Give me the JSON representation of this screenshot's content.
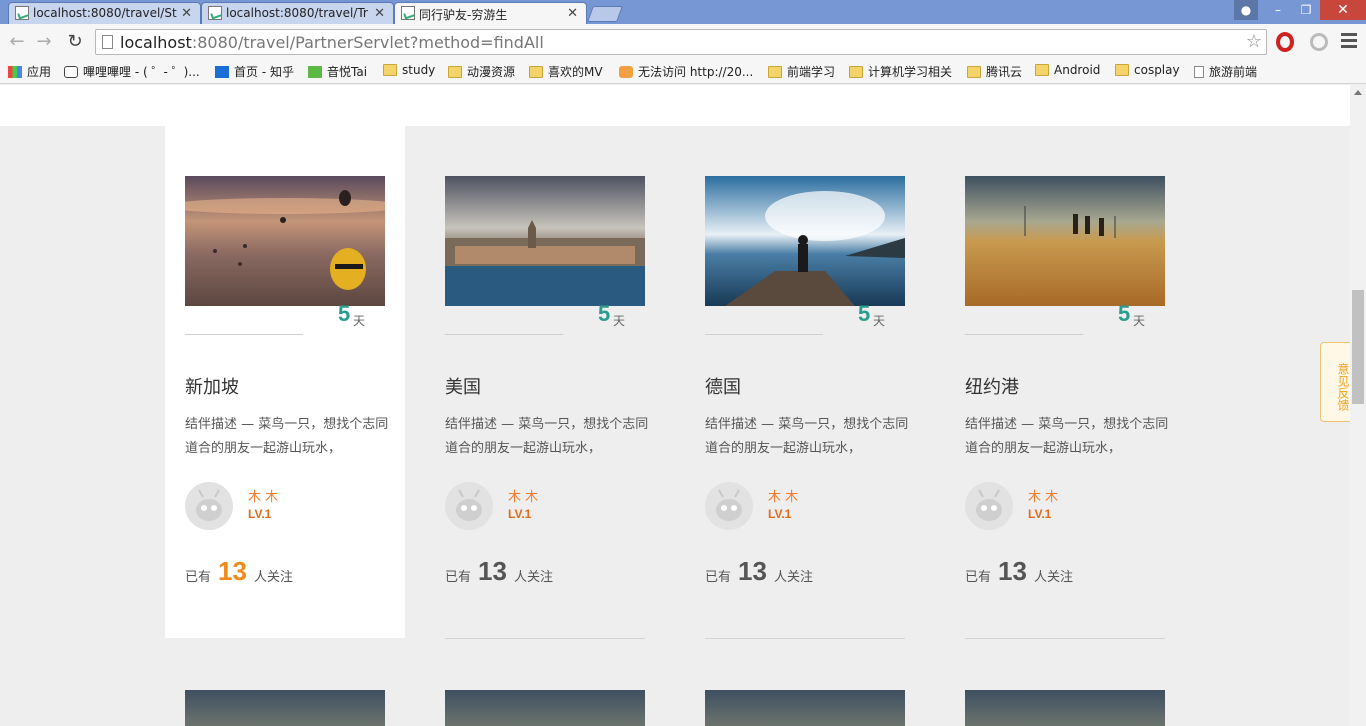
{
  "browser": {
    "tabs": [
      {
        "title": "localhost:8080/travel/St"
      },
      {
        "title": "localhost:8080/travel/Tr"
      },
      {
        "title": "同行驴友-穷游生"
      }
    ],
    "url_host": "localhost",
    "url_path": ":8080/travel/PartnerServlet?method=findAll",
    "bookmarks": [
      {
        "label": "应用",
        "icon": "apps-icon"
      },
      {
        "label": "嗶哩嗶哩 - ( ゜- ゜)...",
        "icon": "tv-icon"
      },
      {
        "label": "首页 - 知乎",
        "icon": "zhihu-icon"
      },
      {
        "label": "音悦Tai",
        "icon": "yinyuetai-icon"
      },
      {
        "label": "study",
        "icon": "folder-icon"
      },
      {
        "label": "动漫资源",
        "icon": "folder-icon"
      },
      {
        "label": "喜欢的MV",
        "icon": "folder-icon"
      },
      {
        "label": "无法访问 http://20...",
        "icon": "mu-icon"
      },
      {
        "label": "前端学习",
        "icon": "folder-icon"
      },
      {
        "label": "计算机学习相关",
        "icon": "folder-icon"
      },
      {
        "label": "腾讯云",
        "icon": "folder-icon"
      },
      {
        "label": "Android",
        "icon": "folder-icon"
      },
      {
        "label": "cosplay",
        "icon": "folder-icon"
      },
      {
        "label": "旅游前端",
        "icon": "page-icon"
      }
    ]
  },
  "feedback": {
    "label": "意见反馈"
  },
  "cards": [
    {
      "city": "新加坡",
      "days": "5",
      "days_unit": "天",
      "desc": "结伴描述 — 菜鸟一只，想找个志同道合的朋友一起游山玩水，",
      "user": "木 木",
      "level": "LV.1",
      "follow_pre": "已有",
      "follow_count": "13",
      "follow_post": "人关注",
      "highlight": true
    },
    {
      "city": "美国",
      "days": "5",
      "days_unit": "天",
      "desc": "结伴描述 — 菜鸟一只，想找个志同道合的朋友一起游山玩水，",
      "user": "木 木",
      "level": "LV.1",
      "follow_pre": "已有",
      "follow_count": "13",
      "follow_post": "人关注",
      "highlight": false
    },
    {
      "city": "德国",
      "days": "5",
      "days_unit": "天",
      "desc": "结伴描述 — 菜鸟一只，想找个志同道合的朋友一起游山玩水，",
      "user": "木 木",
      "level": "LV.1",
      "follow_pre": "已有",
      "follow_count": "13",
      "follow_post": "人关注",
      "highlight": false
    },
    {
      "city": "纽约港",
      "days": "5",
      "days_unit": "天",
      "desc": "结伴描述 — 菜鸟一只，想找个志同道合的朋友一起游山玩水，",
      "user": "木 木",
      "level": "LV.1",
      "follow_pre": "已有",
      "follow_count": "13",
      "follow_post": "人关注",
      "highlight": false
    }
  ]
}
